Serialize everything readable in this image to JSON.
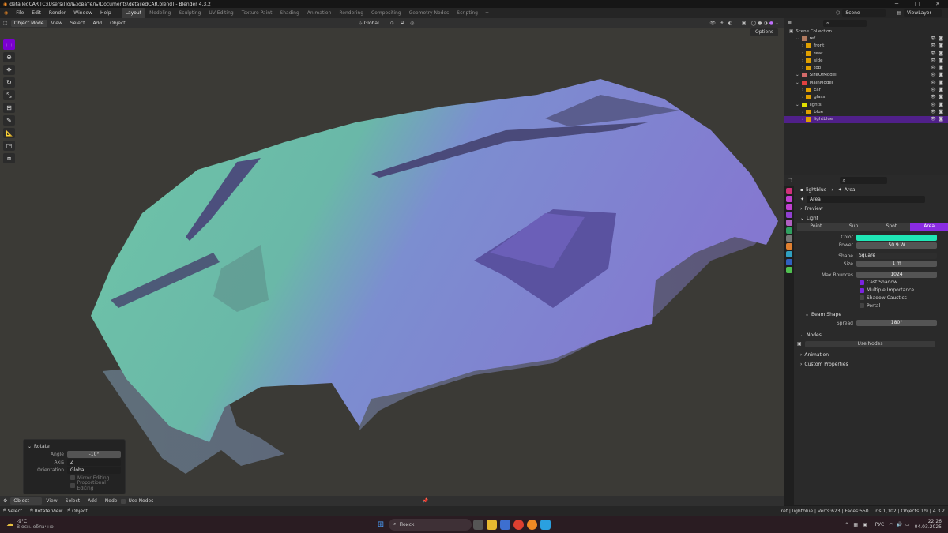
{
  "title": "detailedCAR [C:\\Users\\Пользователь\\Documents\\detailedCAR.blend] - Blender 4.3.2",
  "menu": [
    "File",
    "Edit",
    "Render",
    "Window",
    "Help"
  ],
  "workspaces": [
    "Layout",
    "Modeling",
    "Sculpting",
    "UV Editing",
    "Texture Paint",
    "Shading",
    "Animation",
    "Rendering",
    "Compositing",
    "Geometry Nodes",
    "Scripting"
  ],
  "scene": "Scene",
  "view_layer": "ViewLayer",
  "vp": {
    "mode": "Object Mode",
    "view": "View",
    "select": "Select",
    "add": "Add",
    "object": "Object",
    "orientation": "Global",
    "options": "Options"
  },
  "redo": {
    "title": "Rotate",
    "angle_label": "Angle",
    "angle": "-10°",
    "axis_label": "Axis",
    "axis": "Z",
    "orient_label": "Orientation",
    "orient": "Global",
    "mirror": "Mirror Editing",
    "prop": "Proportional Editing"
  },
  "nodebar": {
    "object": "Object",
    "view": "View",
    "select": "Select",
    "add": "Add",
    "node": "Node",
    "use_nodes": "Use Nodes"
  },
  "outliner": {
    "root": "Scene Collection",
    "items": [
      {
        "label": "ref",
        "indent": 1,
        "color": "#b07a60"
      },
      {
        "label": "front",
        "indent": 2,
        "color": "#e0a000"
      },
      {
        "label": "rear",
        "indent": 2,
        "color": "#e0a000"
      },
      {
        "label": "side",
        "indent": 2,
        "color": "#e0a000"
      },
      {
        "label": "top",
        "indent": 2,
        "color": "#e0a000"
      },
      {
        "label": "SizeOfModel",
        "indent": 1,
        "color": "#d46a6a"
      },
      {
        "label": "MainModel",
        "indent": 1,
        "color": "#e04040"
      },
      {
        "label": "car",
        "indent": 2,
        "color": "#e0a000"
      },
      {
        "label": "glass",
        "indent": 2,
        "color": "#e0a000"
      },
      {
        "label": "lights",
        "indent": 1,
        "color": "#e0e000"
      },
      {
        "label": "blue",
        "indent": 2,
        "color": "#e0a000"
      },
      {
        "label": "lightblue",
        "indent": 2,
        "color": "#e0a000",
        "selected": true
      }
    ]
  },
  "props": {
    "object": "lightblue",
    "data": "Area",
    "datablock": "Area",
    "preview": "Preview",
    "light": "Light",
    "types": [
      "Point",
      "Sun",
      "Spot",
      "Area"
    ],
    "color_label": "Color",
    "color": "#1fe6b6",
    "power_label": "Power",
    "power": "50.9 W",
    "shape_label": "Shape",
    "shape": "Square",
    "size_label": "Size",
    "size": "1 m",
    "bounces_label": "Max Bounces",
    "bounces": "1024",
    "cast_shadow": "Cast Shadow",
    "mis": "Multiple Importance",
    "caustics": "Shadow Caustics",
    "portal": "Portal",
    "beam": "Beam Shape",
    "spread_label": "Spread",
    "spread": "180°",
    "nodes": "Nodes",
    "use_nodes": "Use Nodes",
    "animation": "Animation",
    "custom": "Custom Properties"
  },
  "status": {
    "select": "Select",
    "rotate": "Rotate View",
    "object": "Object",
    "info": "ref | lightblue | Verts:623 | Faces:550 | Tris:1,102 | Objects:1/9 | 4.3.2"
  },
  "taskbar": {
    "temp": "-9°C",
    "weather": "В осн. облачно",
    "search": "Поиск",
    "lang": "РУС",
    "time": "22:26",
    "date": "04.03.2025"
  }
}
